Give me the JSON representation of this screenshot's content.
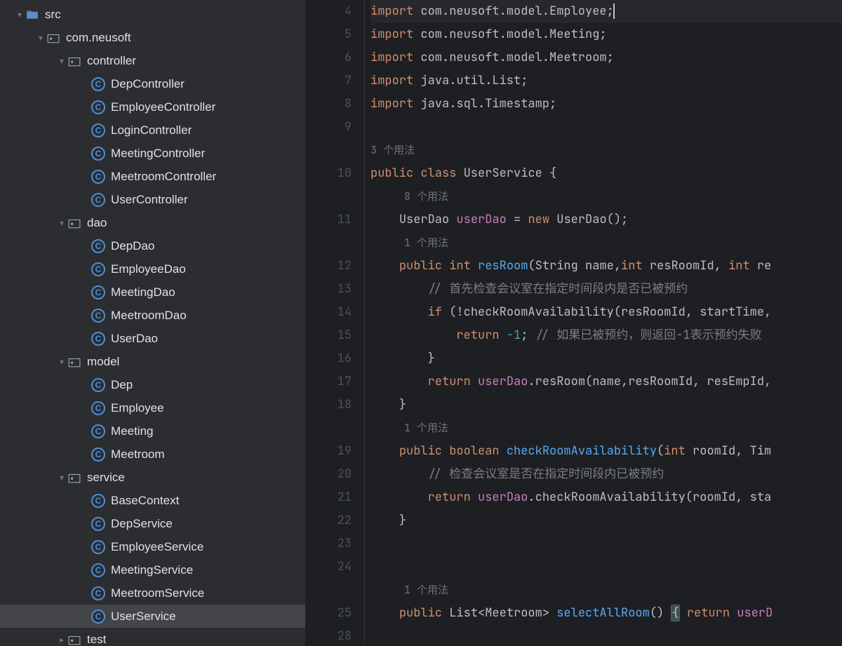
{
  "tree": {
    "src": "src",
    "package": "com.neusoft",
    "controller": {
      "label": "controller",
      "items": [
        "DepController",
        "EmployeeController",
        "LoginController",
        "MeetingController",
        "MeetroomController",
        "UserController"
      ]
    },
    "dao": {
      "label": "dao",
      "items": [
        "DepDao",
        "EmployeeDao",
        "MeetingDao",
        "MeetroomDao",
        "UserDao"
      ]
    },
    "model": {
      "label": "model",
      "items": [
        "Dep",
        "Employee",
        "Meeting",
        "Meetroom"
      ]
    },
    "service": {
      "label": "service",
      "items": [
        "BaseContext",
        "DepService",
        "EmployeeService",
        "MeetingService",
        "MeetroomService",
        "UserService"
      ]
    },
    "test": "test"
  },
  "editor": {
    "usageHints": {
      "classUsage": "3 个用法",
      "fieldUsage": "8 个用法",
      "method1Usage": "1 个用法",
      "method2Usage": "1 个用法",
      "method3Usage": "1 个用法"
    },
    "lines": {
      "4": {
        "kw": "import",
        "rest": " com.neusoft.model.Employee;"
      },
      "5": {
        "kw": "import",
        "rest": " com.neusoft.model.Meeting;"
      },
      "6": {
        "kw": "import",
        "rest": " com.neusoft.model.Meetroom;"
      },
      "7": {
        "kw": "import",
        "rest": " java.util.List;"
      },
      "8": {
        "kw": "import",
        "rest": " java.sql.Timestamp;"
      },
      "10": {
        "kw1": "public",
        "kw2": "class",
        "cls": "UserService",
        "brace": "{"
      },
      "11": {
        "type": "UserDao",
        "field": "userDao",
        "eq": " = ",
        "kw": "new",
        "ctor": "UserDao",
        "paren": "();"
      },
      "12": {
        "kw1": "public",
        "kw2": "int",
        "method": "resRoom",
        "params1": "(String name,",
        "kw3": "int",
        "params2": " resRoomId, ",
        "kw4": "int",
        "params3": " re"
      },
      "13": {
        "comment": "// 首先检查会议室在指定时间段内是否已被预约"
      },
      "14": {
        "kw": "if",
        "cond": " (!checkRoomAvailability(resRoomId, startTime,"
      },
      "15": {
        "kw": "return",
        "num": "-1",
        "semi": "; ",
        "comment": "// 如果已被预约，则返回-1表示预约失败"
      },
      "16": {
        "brace": "}"
      },
      "17": {
        "kw": "return",
        "field": "userDao",
        "dot": ".resRoom(name,resRoomId, resEmpId,"
      },
      "18": {
        "brace": "}"
      },
      "19": {
        "kw1": "public",
        "kw2": "boolean",
        "method": "checkRoomAvailability",
        "params": "(",
        "kw3": "int",
        "params2": " roomId, Tim"
      },
      "20": {
        "comment": "// 检查会议室是否在指定时间段内已被预约"
      },
      "21": {
        "kw": "return",
        "field": "userDao",
        "dot": ".checkRoomAvailability(roomId, sta"
      },
      "22": {
        "brace": "}"
      },
      "25": {
        "kw1": "public",
        "type": "List<Meetroom>",
        "method": "selectAllRoom",
        "paren": "() ",
        "brace": "{",
        "kw2": "return",
        "field": "userD"
      }
    },
    "lineNumbers": [
      "4",
      "5",
      "6",
      "7",
      "8",
      "9",
      "",
      "10",
      "",
      "11",
      "",
      "12",
      "13",
      "14",
      "15",
      "16",
      "17",
      "18",
      "",
      "19",
      "20",
      "21",
      "22",
      "23",
      "24",
      "",
      "25",
      "28"
    ]
  }
}
